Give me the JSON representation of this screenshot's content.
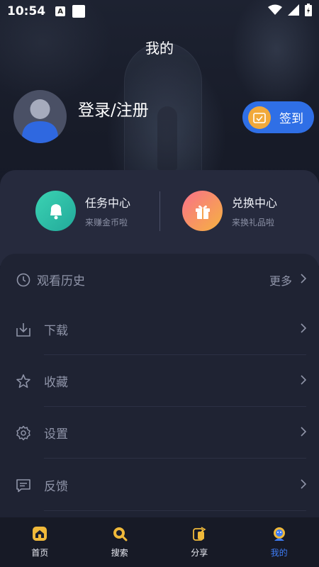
{
  "status_bar": {
    "time": "10:54",
    "notif_letter": "A"
  },
  "header": {
    "title": "我的"
  },
  "profile": {
    "login_label": "登录/注册",
    "checkin_label": "签到"
  },
  "rewards": [
    {
      "title": "任务中心",
      "subtitle": "来赚金币啦",
      "icon": "bell-icon"
    },
    {
      "title": "兑换中心",
      "subtitle": "来换礼品啦",
      "icon": "gift-icon"
    }
  ],
  "menu": {
    "history": {
      "label": "观看历史",
      "more": "更多"
    },
    "items": [
      {
        "label": "下载",
        "icon": "download-icon"
      },
      {
        "label": "收藏",
        "icon": "star-icon"
      },
      {
        "label": "设置",
        "icon": "gear-icon"
      },
      {
        "label": "反馈",
        "icon": "feedback-icon"
      }
    ]
  },
  "bottom_nav": [
    {
      "label": "首页",
      "icon": "home-icon"
    },
    {
      "label": "搜索",
      "icon": "search-icon"
    },
    {
      "label": "分享",
      "icon": "share-icon"
    },
    {
      "label": "我的",
      "icon": "profile-icon",
      "active": true
    }
  ],
  "colors": {
    "accent": "#3e7cf5",
    "checkin_button": "#2f6fe6",
    "task_icon": "#2ec4a8",
    "gift_icon": "#f7846a",
    "nav_icon": "#f0b93a"
  }
}
